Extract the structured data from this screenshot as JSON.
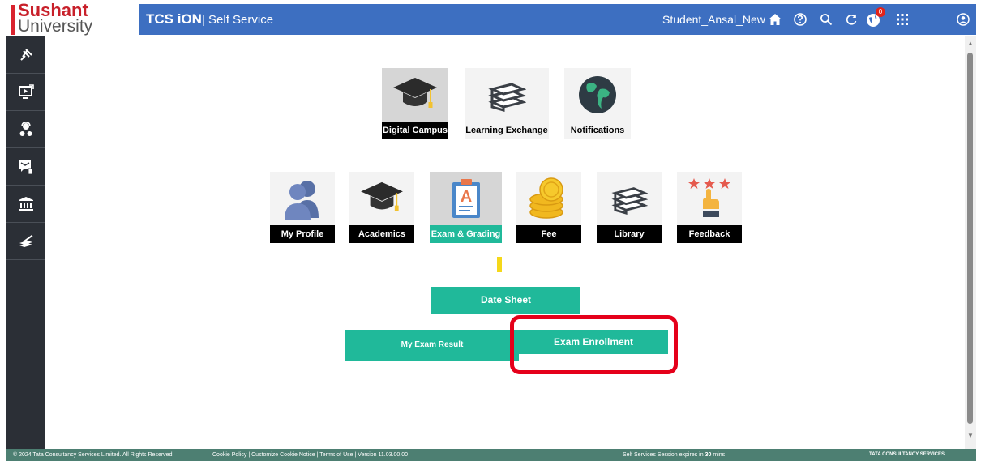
{
  "logo": {
    "line1": "Sushant",
    "line2": "University"
  },
  "topbar": {
    "brand": "TCS iON",
    "brand_sub": "| Self Service",
    "user": "Student_Ansal_New",
    "notification_count": "0"
  },
  "apps_top": [
    {
      "label": "Digital Campus",
      "icon": "graduation-cap"
    },
    {
      "label": "Learning Exchange",
      "icon": "books"
    },
    {
      "label": "Notifications",
      "icon": "globe"
    }
  ],
  "apps_main": [
    {
      "label": "My Profile",
      "icon": "user-silhouette"
    },
    {
      "label": "Academics",
      "icon": "graduation-cap"
    },
    {
      "label": "Exam & Grading",
      "icon": "grade-clipboard"
    },
    {
      "label": "Fee",
      "icon": "coins"
    },
    {
      "label": "Library",
      "icon": "books"
    },
    {
      "label": "Feedback",
      "icon": "stars-hand"
    }
  ],
  "actions": {
    "date_sheet": "Date Sheet",
    "my_exam_result": "My Exam Result",
    "exam_enrollment": "Exam Enrollment"
  },
  "footer": {
    "copyright": "© 2024 Tata Consultancy Services Limited. All Rights Reserved.",
    "links": "Cookie Policy | Customize Cookie Notice | Terms of Use | Version 11.03.00.00",
    "session_prefix": "Self Services Session expires in",
    "session_minutes": "30",
    "session_suffix": "mins",
    "tcs": "TATA CONSULTANCY SERVICES"
  },
  "colors": {
    "topbar": "#3d6fc1",
    "sidebar": "#2b2f36",
    "accent": "#20b99a",
    "highlight": "#e5001a"
  }
}
